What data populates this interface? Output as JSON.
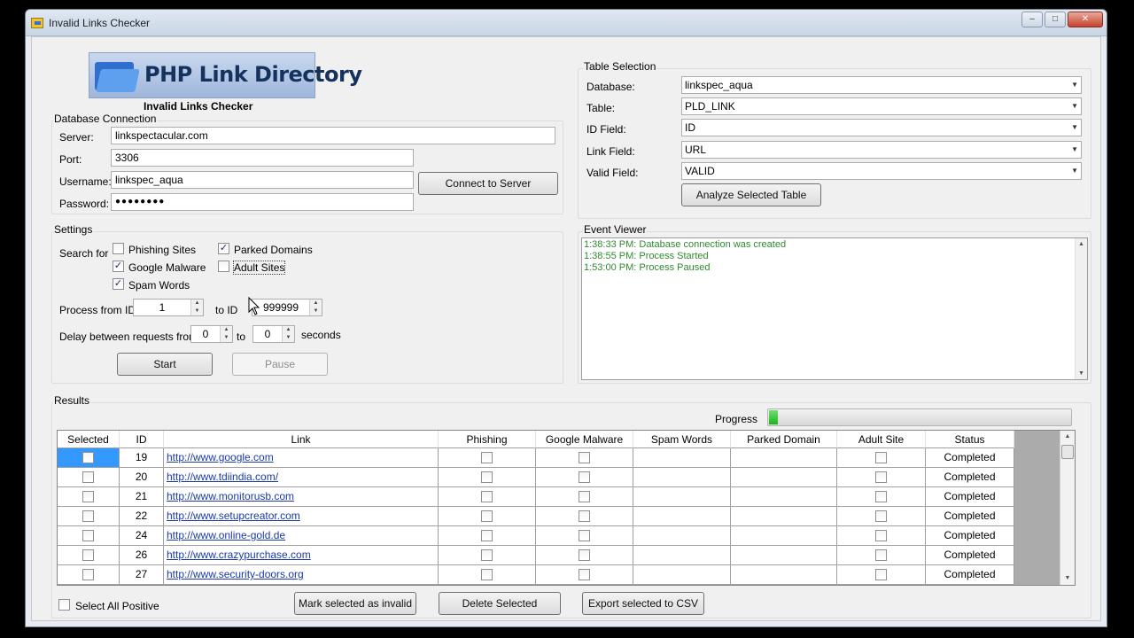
{
  "window": {
    "title": "Invalid Links Checker",
    "controls": {
      "minimize": "–",
      "maximize": "□",
      "close": "✕"
    }
  },
  "logo": {
    "text": "PHP Link Directory",
    "subtitle": "Invalid Links Checker"
  },
  "db": {
    "group_title": "Database Connection",
    "server_label": "Server:",
    "server_value": "linkspectacular.com",
    "port_label": "Port:",
    "port_value": "3306",
    "username_label": "Username:",
    "username_value": "linkspec_aqua",
    "password_label": "Password:",
    "password_value": "●●●●●●●●",
    "connect_button": "Connect to Server"
  },
  "settings": {
    "group_title": "Settings",
    "search_for_label": "Search for",
    "checkboxes": {
      "phishing": {
        "label": "Phishing Sites",
        "checked": false
      },
      "google_malware": {
        "label": "Google Malware",
        "checked": true
      },
      "spam_words": {
        "label": "Spam Words",
        "checked": true
      },
      "parked_domains": {
        "label": "Parked Domains",
        "checked": true
      },
      "adult_sites": {
        "label": "Adult Sites",
        "checked": false
      }
    },
    "process_from_label": "Process from ID",
    "process_from_value": "1",
    "to_id_label": "to ID",
    "to_id_value": "999999",
    "delay_label": "Delay between requests from",
    "delay_from_value": "0",
    "delay_to_label": "to",
    "delay_to_value": "0",
    "seconds_label": "seconds",
    "start_button": "Start",
    "pause_button": "Pause"
  },
  "table_selection": {
    "group_title": "Table Selection",
    "database_label": "Database:",
    "database_value": "linkspec_aqua",
    "table_label": "Table:",
    "table_value": "PLD_LINK",
    "id_field_label": "ID Field:",
    "id_field_value": "ID",
    "link_field_label": "Link Field:",
    "link_field_value": "URL",
    "valid_field_label": "Valid Field:",
    "valid_field_value": "VALID",
    "analyze_button": "Analyze Selected Table"
  },
  "event_viewer": {
    "group_title": "Event Viewer",
    "lines": [
      "1:38:33 PM: Database connection was created",
      "1:38:55 PM: Process Started",
      "1:53:00 PM: Process Paused"
    ]
  },
  "results": {
    "group_title": "Results",
    "progress_label": "Progress",
    "progress_fraction": 0.03,
    "columns": [
      "Selected",
      "ID",
      "Link",
      "Phishing",
      "Google Malware",
      "Spam Words",
      "Parked Domain",
      "Adult Site",
      "Status"
    ],
    "rows": [
      {
        "id": "19",
        "link": "http://www.google.com",
        "status": "Completed"
      },
      {
        "id": "20",
        "link": "http://www.tdiindia.com/",
        "status": "Completed"
      },
      {
        "id": "21",
        "link": "http://www.monitorusb.com",
        "status": "Completed"
      },
      {
        "id": "22",
        "link": "http://www.setupcreator.com",
        "status": "Completed"
      },
      {
        "id": "24",
        "link": "http://www.online-gold.de",
        "status": "Completed"
      },
      {
        "id": "26",
        "link": "http://www.crazypurchase.com",
        "status": "Completed"
      },
      {
        "id": "27",
        "link": "http://www.security-doors.org",
        "status": "Completed"
      }
    ],
    "select_all_label": "Select All Positive",
    "mark_invalid_button": "Mark selected as invalid",
    "delete_button": "Delete Selected",
    "export_button": "Export selected to CSV"
  }
}
